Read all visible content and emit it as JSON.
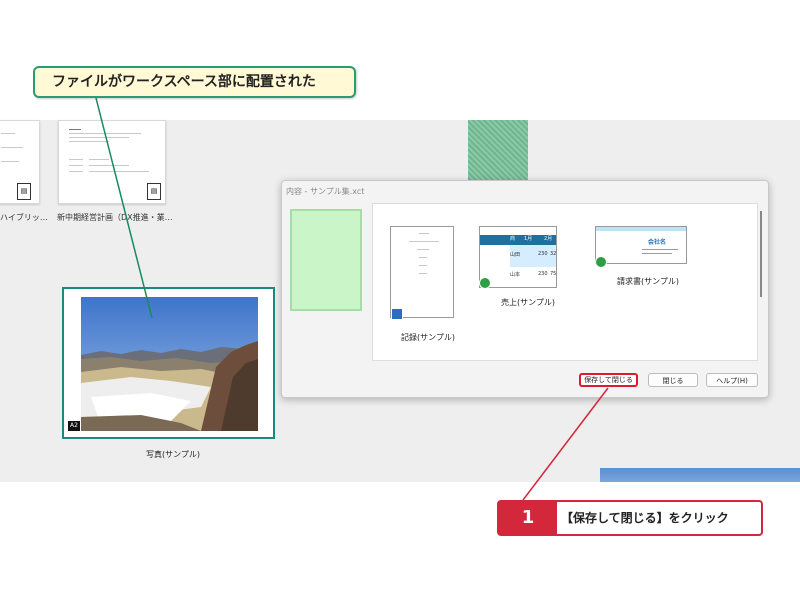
{
  "callout_top": {
    "text": "ファイルがワークスペース部に配置された"
  },
  "workspace": {
    "thumb1_caption": "ハイブリッ…",
    "thumb2_caption": "新中期経営計画（DX推進・業…"
  },
  "photo_card": {
    "caption": "写真(サンプル)",
    "badge": "A2"
  },
  "dialog": {
    "title": "内容 - サンプル集.xct",
    "files": [
      {
        "caption": "記録(サンプル)"
      },
      {
        "caption": "売上(サンプル)"
      },
      {
        "caption": "請求書(サンプル)"
      }
    ],
    "sales_thumb": {
      "headers": [
        "商",
        "1月",
        "2月"
      ],
      "rows": [
        [
          "山田",
          "230",
          "325"
        ],
        [
          "山本",
          "230",
          "75"
        ]
      ]
    },
    "invoice_thumb": {
      "company": "会社名"
    },
    "buttons": {
      "save_close": "保存して閉じる",
      "close": "閉じる",
      "help": "ヘルプ(H)"
    }
  },
  "step": {
    "number": "1",
    "text": "【保存して閉じる】をクリック"
  },
  "colors": {
    "accent_red": "#d3283c",
    "teal": "#1a8a80",
    "callout_bg": "#fff9d6"
  }
}
